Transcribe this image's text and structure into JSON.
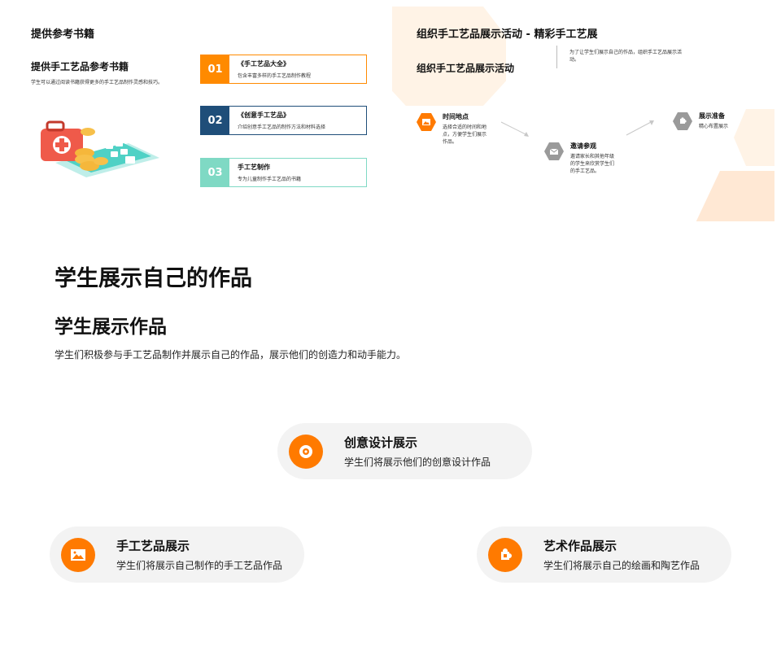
{
  "slide1": {
    "title": "提供参考书籍",
    "subtitle": "提供手工艺品参考书籍",
    "desc": "学生可以通过阅读书籍获得更多的手工艺品制作灵感和技巧。",
    "books": [
      {
        "num": "01",
        "title": "《手工艺品大全》",
        "desc": "包含丰富多样的手工艺品制作教程",
        "color": "#ff8a00"
      },
      {
        "num": "02",
        "title": "《创意手工艺品》",
        "desc": "介绍创意手工艺品的制作方法和材料选择",
        "color": "#1f4e79"
      },
      {
        "num": "03",
        "title": "手工艺制作",
        "desc": "专为儿童制作手工艺品的书籍",
        "color": "#7fd9c4"
      }
    ]
  },
  "slide2": {
    "title": "组织手工艺品展示活动 - 精彩手工艺展",
    "subtitle": "组织手工艺品展示活动",
    "note": "为了让学生们展示自己的作品，组织手工艺品展示活动。",
    "steps": [
      {
        "title": "时间地点",
        "desc": "选择合适的时间和地点，方便学生们展示作品。",
        "icon": "image-icon",
        "color": "#ff7a00"
      },
      {
        "title": "邀请参观",
        "desc": "邀请家长和其他年级的学生来欣赏学生们的手工艺品。",
        "icon": "envelope-icon",
        "color": "#9a9a9a"
      },
      {
        "title": "展示准备",
        "desc": "精心布置展示",
        "icon": "puzzle-icon",
        "color": "#9a9a9a"
      }
    ]
  },
  "slide3": {
    "title": "学生展示自己的作品",
    "subtitle": "学生展示作品",
    "desc": "学生们积极参与手工艺品制作并展示自己的作品，展示他们的创造力和动手能力。",
    "cards": [
      {
        "title": "创意设计展示",
        "desc": "学生们将展示他们的创意设计作品",
        "icon": "target-icon"
      },
      {
        "title": "手工艺品展示",
        "desc": "学生们将展示自己制作的手工艺品作品",
        "icon": "picture-icon"
      },
      {
        "title": "艺术作品展示",
        "desc": "学生们将展示自己的绘画和陶艺作品",
        "icon": "puzzle-icon"
      }
    ],
    "accent": "#ff7a00"
  }
}
